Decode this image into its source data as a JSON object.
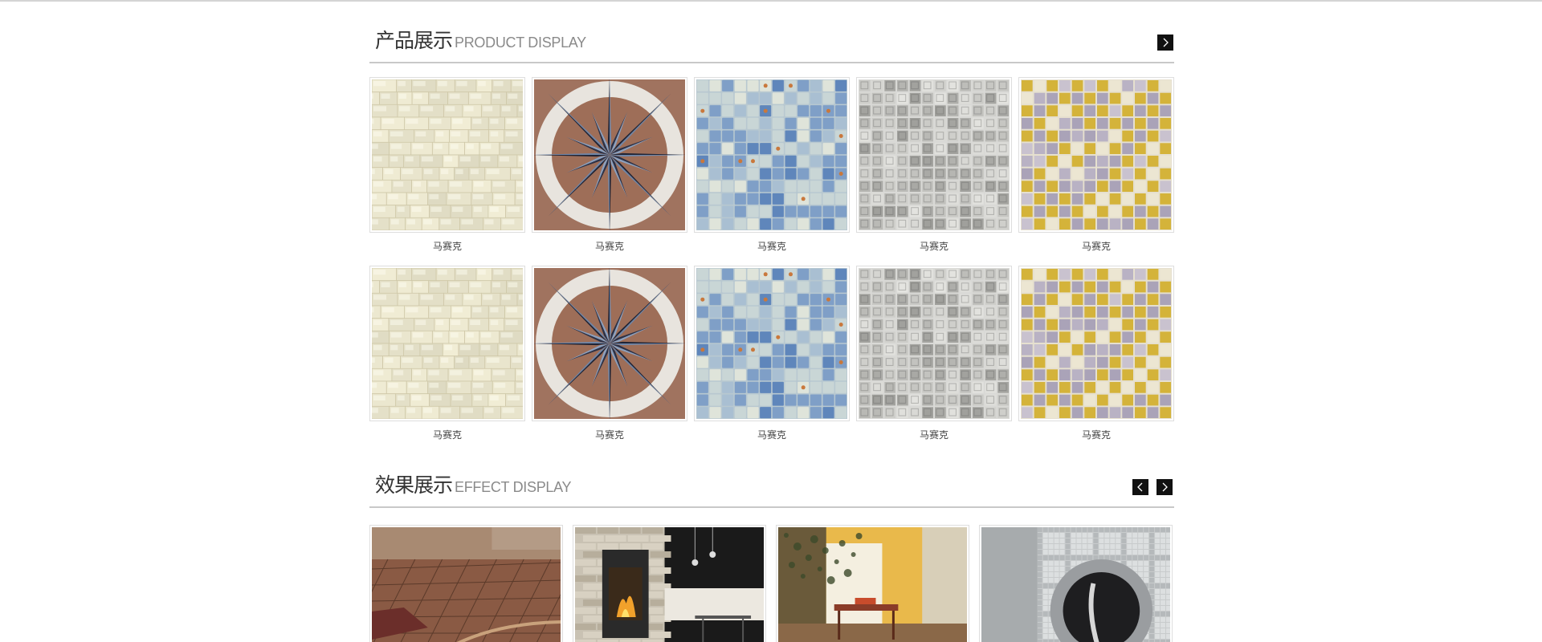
{
  "products": {
    "title_cn": "产品展示",
    "title_en": "PRODUCT DISPLAY",
    "next_icon": "chevron-right-icon",
    "items": [
      {
        "name": "马赛克",
        "pattern": "cream-stone"
      },
      {
        "name": "马赛克",
        "pattern": "compass-star"
      },
      {
        "name": "马赛克",
        "pattern": "blue-glass"
      },
      {
        "name": "马赛克",
        "pattern": "silver-grid"
      },
      {
        "name": "马赛克",
        "pattern": "gold-check"
      },
      {
        "name": "马赛克",
        "pattern": "cream-stone"
      },
      {
        "name": "马赛克",
        "pattern": "compass-star"
      },
      {
        "name": "马赛克",
        "pattern": "blue-glass"
      },
      {
        "name": "马赛克",
        "pattern": "silver-grid"
      },
      {
        "name": "马赛克",
        "pattern": "gold-check"
      }
    ]
  },
  "effects": {
    "title_cn": "效果展示",
    "title_en": "EFFECT DISPLAY",
    "prev_icon": "chevron-left-icon",
    "next_icon": "chevron-right-icon",
    "items": [
      {
        "scene": "tiled-floor"
      },
      {
        "scene": "fireplace-room"
      },
      {
        "scene": "dining-room"
      },
      {
        "scene": "mosaic-mirror"
      }
    ]
  },
  "colors": {
    "divider": "#c8c8c8",
    "arrow_bg": "#111111",
    "title_en": "#8a8a8a"
  }
}
